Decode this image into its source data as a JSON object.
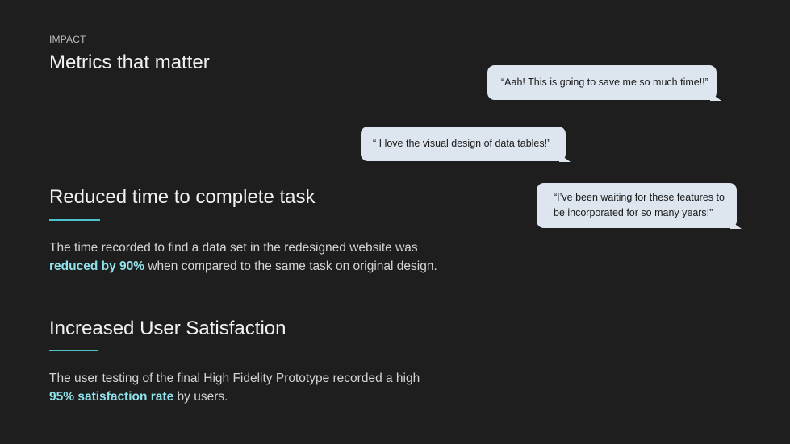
{
  "eyebrow": "IMPACT",
  "title": "Metrics that matter",
  "sections": [
    {
      "heading": "Reduced time to complete task",
      "body_lead": "The time recorded to find a data set in the redesigned website was",
      "highlight": "reduced by 90%",
      "body_tail": "when compared to the same task on original design."
    },
    {
      "heading": "Increased User Satisfaction",
      "body_lead": "The user testing of the final High Fidelity Prototype recorded a high",
      "highlight": "95% satisfaction rate",
      "body_tail": "by users."
    }
  ],
  "quotes": [
    "“Aah! This is going to save me so much time!!”",
    "“ I love the visual design of data tables!”",
    "“I’ve been waiting for these features to be incorporated for so many years!”"
  ],
  "colors": {
    "background": "#1e1e1e",
    "accent": "#4cc3cc",
    "highlight_text": "#8fe1ea",
    "bubble": "#dde5ee"
  }
}
